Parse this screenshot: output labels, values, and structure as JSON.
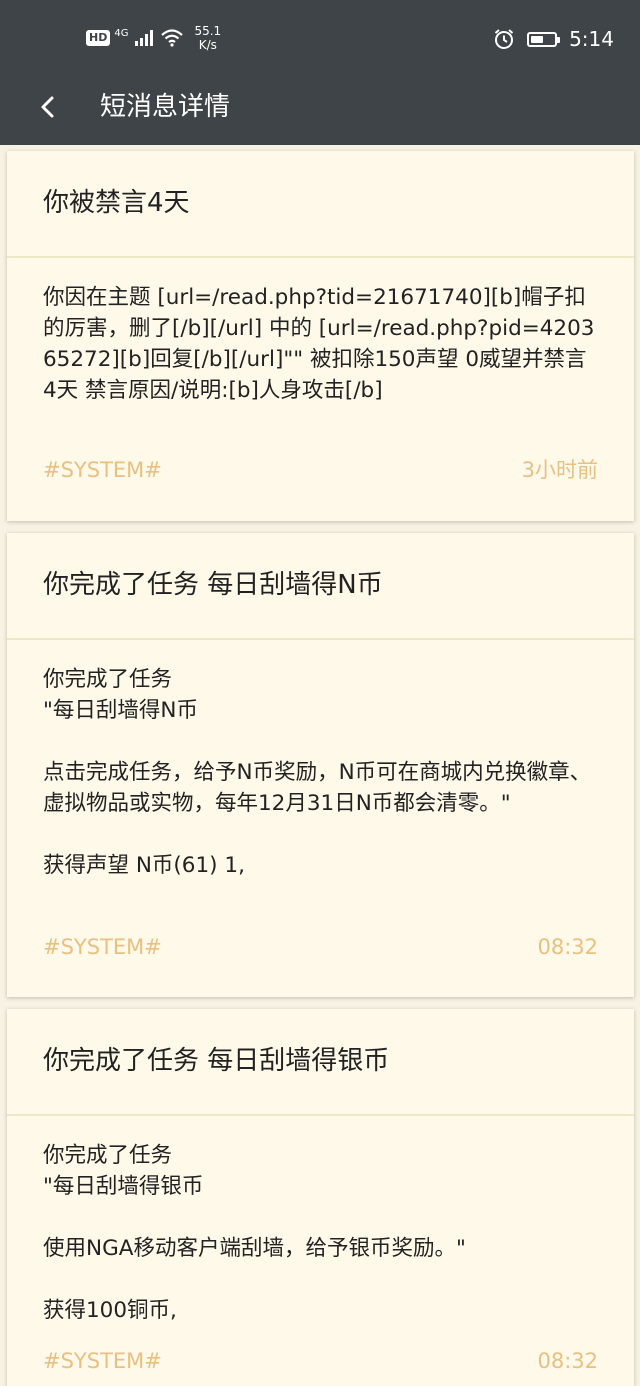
{
  "status_bar": {
    "hd": "HD",
    "net": "4G",
    "speed_value": "55.1",
    "speed_unit": "K/s",
    "time": "5:14",
    "battery_level": 0.55
  },
  "app_bar": {
    "back_icon": "back-arrow-icon",
    "title": "短消息详情"
  },
  "messages": [
    {
      "title": "你被禁言4天",
      "body": "你因在主题 [url=/read.php?tid=21671740][b]帽子扣的厉害，删了[/b][/url] 中的 [url=/read.php?pid=420365272][b]回复[/b][/url]\"\" 被扣除150声望 0威望并禁言4天 禁言原因/说明:[b]人身攻击[/b]",
      "sender": "#SYSTEM#",
      "time": "3小时前"
    },
    {
      "title": "你完成了任务 每日刮墙得N币",
      "body": "你完成了任务\n\"每日刮墙得N币\n\n点击完成任务，给予N币奖励，N币可在商城内兑换徽章、虚拟物品或实物，每年12月31日N币都会清零。\"\n\n获得声望 N币(61) 1,",
      "sender": "#SYSTEM#",
      "time": "08:32"
    },
    {
      "title": "你完成了任务 每日刮墙得银币",
      "body": "你完成了任务\n\"每日刮墙得银币\n\n使用NGA移动客户端刮墙，给予银币奖励。\"\n\n获得100铜币,",
      "sender": "#SYSTEM#",
      "time": "08:32"
    }
  ]
}
